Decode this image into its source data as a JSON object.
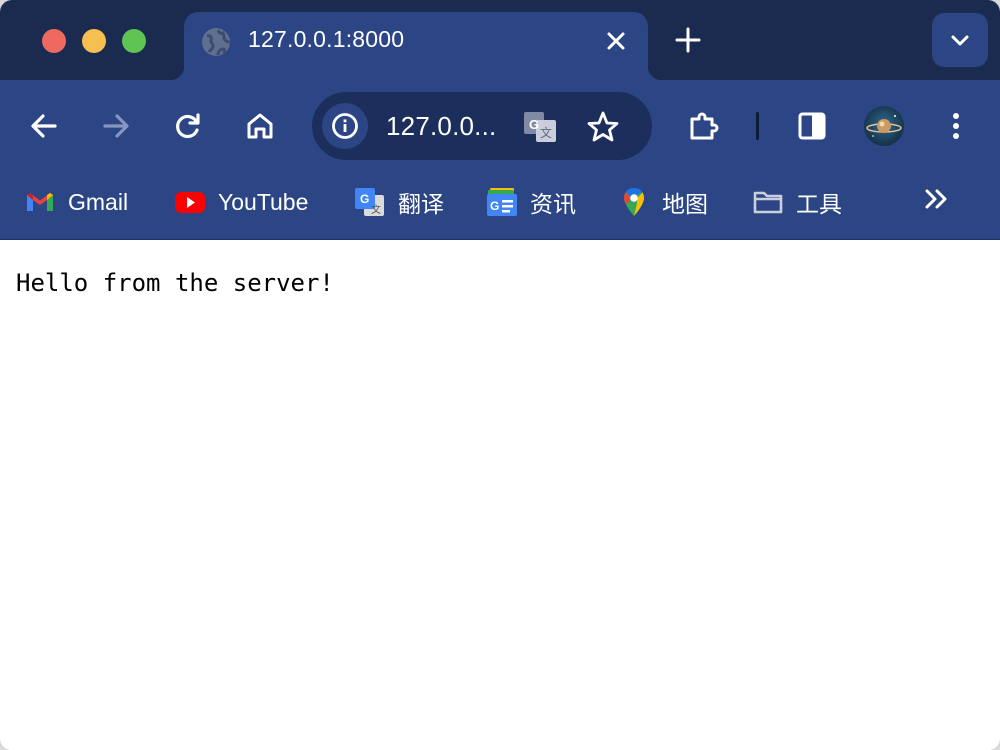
{
  "tab": {
    "title": "127.0.0.1:8000",
    "favicon": "globe-icon",
    "close": "close-icon"
  },
  "toolbar": {
    "url": "127.0.0...",
    "icons": [
      "back-arrow-icon",
      "forward-arrow-icon",
      "reload-icon",
      "home-icon",
      "site-info-icon",
      "translate-icon",
      "bookmark-star-icon",
      "extensions-icon",
      "side-panel-icon",
      "profile-avatar",
      "more-menu-icon"
    ]
  },
  "bookmarks": [
    {
      "label": "Gmail",
      "icon": "gmail-icon"
    },
    {
      "label": "YouTube",
      "icon": "youtube-icon"
    },
    {
      "label": "翻译",
      "icon": "google-translate-icon"
    },
    {
      "label": "资讯",
      "icon": "google-news-icon"
    },
    {
      "label": "地图",
      "icon": "google-maps-icon"
    },
    {
      "label": "工具",
      "icon": "folder-icon"
    }
  ],
  "page": {
    "content": "Hello from the server!"
  },
  "colors": {
    "tabstrip": "#1b2a4f",
    "toolbar": "#2b4585",
    "omnibox": "#1c2e5c",
    "close_dot": "#ee6a5f",
    "minimize_dot": "#f5c04f",
    "zoom_dot": "#5ec454"
  }
}
